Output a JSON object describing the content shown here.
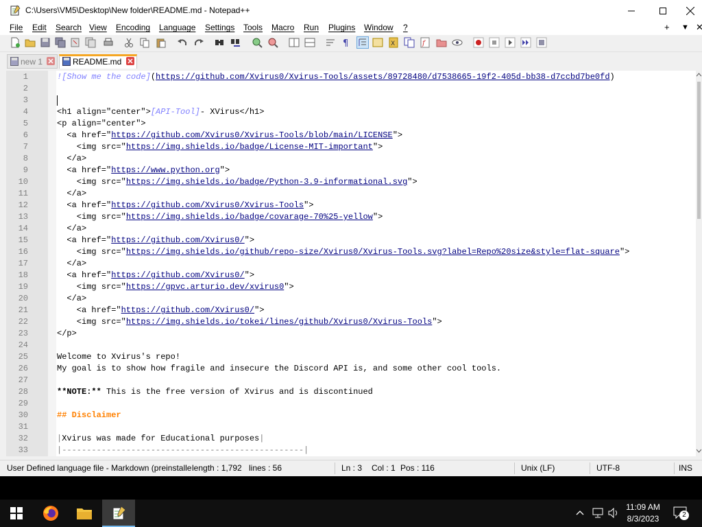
{
  "window": {
    "title": "C:\\Users\\VM5\\Desktop\\New folder\\README.md - Notepad++",
    "app_icon": "notepad-plus-plus-icon"
  },
  "menu": {
    "items": [
      "File",
      "Edit",
      "Search",
      "View",
      "Encoding",
      "Language",
      "Settings",
      "Tools",
      "Macro",
      "Run",
      "Plugins",
      "Window",
      "?"
    ],
    "right": [
      "+",
      "▼",
      "✕"
    ]
  },
  "tabs": [
    {
      "label": "new 1",
      "active": false
    },
    {
      "label": "README.md",
      "active": true
    }
  ],
  "editor": {
    "current_line": 3,
    "lines": [
      {
        "n": "1",
        "segs": [
          [
            "mkb",
            "![Show me the code]"
          ],
          [
            "",
            "("
          ],
          [
            "mku",
            "https://github.com/Xvirus0/Xvirus-Tools/assets/89728480/d7538665-19f2-405d-bb38-d7ccbd7be0fd"
          ],
          [
            "",
            ")"
          ]
        ]
      },
      {
        "n": "2",
        "segs": []
      },
      {
        "n": "3",
        "segs": []
      },
      {
        "n": "4",
        "segs": [
          [
            "",
            "<h1 align=\"center\">"
          ],
          [
            "mkb",
            "[API-Tool]"
          ],
          [
            "",
            "- XVirus</h1>"
          ]
        ]
      },
      {
        "n": "5",
        "segs": [
          [
            "",
            "<p align=\"center\">"
          ]
        ]
      },
      {
        "n": "6",
        "segs": [
          [
            "",
            "  <a href=\""
          ],
          [
            "mku",
            "https://github.com/Xvirus0/Xvirus-Tools/blob/main/LICENSE"
          ],
          [
            "",
            "\">"
          ]
        ]
      },
      {
        "n": "7",
        "segs": [
          [
            "",
            "    <img src=\""
          ],
          [
            "mku",
            "https://img.shields.io/badge/License-MIT-important"
          ],
          [
            "",
            "\">"
          ]
        ]
      },
      {
        "n": "8",
        "segs": [
          [
            "",
            "  </a>"
          ]
        ]
      },
      {
        "n": "9",
        "segs": [
          [
            "",
            "  <a href=\""
          ],
          [
            "mku",
            "https://www.python.org"
          ],
          [
            "",
            "\">"
          ]
        ]
      },
      {
        "n": "10",
        "segs": [
          [
            "",
            "    <img src=\""
          ],
          [
            "mku",
            "https://img.shields.io/badge/Python-3.9-informational.svg"
          ],
          [
            "",
            "\">"
          ]
        ]
      },
      {
        "n": "11",
        "segs": [
          [
            "",
            "  </a>"
          ]
        ]
      },
      {
        "n": "12",
        "segs": [
          [
            "",
            "  <a href=\""
          ],
          [
            "mku",
            "https://github.com/Xvirus0/Xvirus-Tools"
          ],
          [
            "",
            "\">"
          ]
        ]
      },
      {
        "n": "13",
        "segs": [
          [
            "",
            "    <img src=\""
          ],
          [
            "mku",
            "https://img.shields.io/badge/covarage-70%25-yellow"
          ],
          [
            "",
            "\">"
          ]
        ]
      },
      {
        "n": "14",
        "segs": [
          [
            "",
            "  </a>"
          ]
        ]
      },
      {
        "n": "15",
        "segs": [
          [
            "",
            "  <a href=\""
          ],
          [
            "mku",
            "https://github.com/Xvirus0/"
          ],
          [
            "",
            "\">"
          ]
        ]
      },
      {
        "n": "16",
        "segs": [
          [
            "",
            "    <img src=\""
          ],
          [
            "mku",
            "https://img.shields.io/github/repo-size/Xvirus0/Xvirus-Tools.svg?label=Repo%20size&style=flat-square"
          ],
          [
            "",
            "\">"
          ]
        ]
      },
      {
        "n": "17",
        "segs": [
          [
            "",
            "  </a>"
          ]
        ]
      },
      {
        "n": "18",
        "segs": [
          [
            "",
            "  <a href=\""
          ],
          [
            "mku",
            "https://github.com/Xvirus0/"
          ],
          [
            "",
            "\">"
          ]
        ]
      },
      {
        "n": "19",
        "segs": [
          [
            "",
            "    <img src=\""
          ],
          [
            "mku",
            "https://gpvc.arturio.dev/xvirus0"
          ],
          [
            "",
            "\">"
          ]
        ]
      },
      {
        "n": "20",
        "segs": [
          [
            "",
            "  </a>"
          ]
        ]
      },
      {
        "n": "21",
        "segs": [
          [
            "",
            "    <a href=\""
          ],
          [
            "mku",
            "https://github.com/Xvirus0/"
          ],
          [
            "",
            "\">"
          ]
        ]
      },
      {
        "n": "22",
        "segs": [
          [
            "",
            "    <img src=\""
          ],
          [
            "mku",
            "https://img.shields.io/tokei/lines/github/Xvirus0/Xvirus-Tools"
          ],
          [
            "",
            "\">"
          ]
        ]
      },
      {
        "n": "23",
        "segs": [
          [
            "",
            "</p>"
          ]
        ]
      },
      {
        "n": "24",
        "segs": []
      },
      {
        "n": "25",
        "segs": [
          [
            "",
            "Welcome to Xvirus's repo!"
          ]
        ]
      },
      {
        "n": "26",
        "segs": [
          [
            "",
            "My goal is to show how fragile and insecure the Discord API is, and some other cool tools."
          ]
        ]
      },
      {
        "n": "27",
        "segs": []
      },
      {
        "n": "28",
        "segs": [
          [
            "mkbold",
            "**NOTE:**"
          ],
          [
            "",
            " This is the free version of Xvirus and is discontinued"
          ]
        ]
      },
      {
        "n": "29",
        "segs": []
      },
      {
        "n": "30",
        "segs": [
          [
            "mkh",
            "## Disclaimer"
          ]
        ]
      },
      {
        "n": "31",
        "segs": []
      },
      {
        "n": "32",
        "segs": [
          [
            "mkc",
            "|"
          ],
          [
            "",
            "Xvirus was made for Educational purposes"
          ],
          [
            "mkc",
            "|"
          ]
        ]
      },
      {
        "n": "33",
        "segs": [
          [
            "mkc",
            "|-------------------------------------------------|"
          ]
        ]
      }
    ]
  },
  "status": {
    "language": "User Defined language file - Markdown (preinstalle",
    "length": "length : 1,792",
    "lines": "lines : 56",
    "ln": "Ln : 3",
    "col": "Col : 1",
    "pos": "Pos : 116",
    "eol": "Unix (LF)",
    "encoding": "UTF-8",
    "mode": "INS"
  },
  "taskbar": {
    "time": "11:09 AM",
    "date": "8/3/2023",
    "notification_count": "2",
    "apps": [
      "start-icon",
      "firefox-icon",
      "file-explorer-icon",
      "notepad-plus-plus-icon"
    ]
  },
  "colors": {
    "tab_accent": "#f5a623",
    "markdown_link_text": "#8080ff",
    "markdown_url": "#000080",
    "markdown_header": "#ff8000"
  }
}
